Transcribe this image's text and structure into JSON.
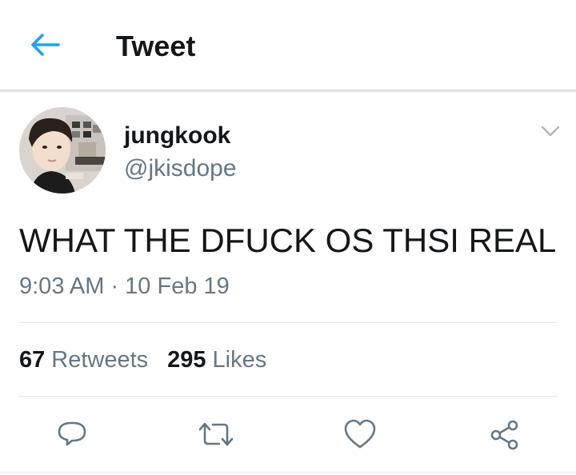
{
  "header": {
    "title": "Tweet",
    "back_icon": "arrow-left-icon",
    "accent_color": "#1da1f2"
  },
  "tweet": {
    "author": {
      "display_name": "jungkook",
      "handle": "@jkisdope"
    },
    "menu_icon": "chevron-down-icon",
    "text": "WHAT THE DFUCK OS THSI REAL",
    "timestamp": "9:03 AM · 10 Feb 19"
  },
  "stats": {
    "retweets_count": "67",
    "retweets_label": "Retweets",
    "likes_count": "295",
    "likes_label": "Likes"
  },
  "actions": [
    {
      "icon": "reply-icon"
    },
    {
      "icon": "retweet-icon"
    },
    {
      "icon": "like-heart-icon"
    },
    {
      "icon": "share-icon"
    }
  ],
  "colors": {
    "text_primary": "#14171a",
    "text_secondary": "#657786",
    "divider": "#e1e8ed"
  }
}
